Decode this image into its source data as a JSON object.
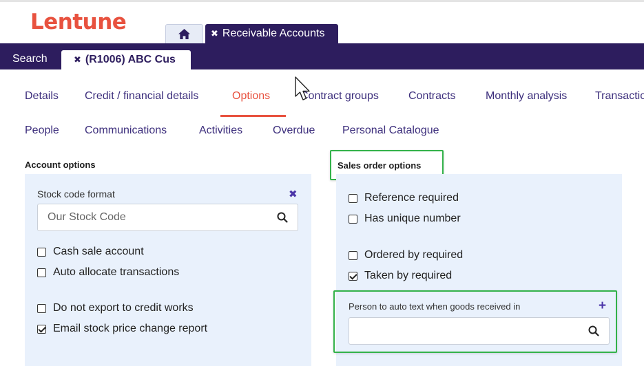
{
  "brand": {
    "logo": "Lentune"
  },
  "module_tabs": {
    "module_label": "Receivable Accounts"
  },
  "bar": {
    "search_label": "Search",
    "record_label": "(R1006) ABC Cus"
  },
  "nav": {
    "row1": [
      "Details",
      "Credit / financial details",
      "Options",
      "Contract groups",
      "Contracts",
      "Monthly analysis",
      "Transactions"
    ],
    "row2": [
      "People",
      "Communications",
      "Activities",
      "Overdue",
      "Personal Catalogue"
    ],
    "active": "Options"
  },
  "account_options": {
    "heading": "Account options",
    "stock_code_label": "Stock code format",
    "stock_code_placeholder": "Our Stock Code",
    "stock_code_value": "",
    "checkboxes": [
      {
        "label": "Cash sale account",
        "checked": false
      },
      {
        "label": "Auto allocate transactions",
        "checked": false
      },
      {
        "label": "Do not export to credit works",
        "checked": false
      },
      {
        "label": "Email stock price change report",
        "checked": true
      }
    ]
  },
  "sales_order_options": {
    "heading": "Sales order options",
    "checkboxes": [
      {
        "label": "Reference required",
        "checked": false
      },
      {
        "label": "Has unique number",
        "checked": false
      },
      {
        "label": "Ordered by required",
        "checked": false
      },
      {
        "label": "Taken by required",
        "checked": true
      }
    ],
    "person_label": "Person to auto text when goods received in",
    "person_value": ""
  },
  "colors": {
    "brand": "#e8523f",
    "nav_bar": "#2d1d5e",
    "link": "#3c2e7c",
    "panel": "#e9f1fc",
    "highlight": "#33b24a"
  },
  "icons": [
    "home-icon",
    "close-icon",
    "search-icon",
    "plus-icon",
    "mouse-cursor-icon"
  ]
}
